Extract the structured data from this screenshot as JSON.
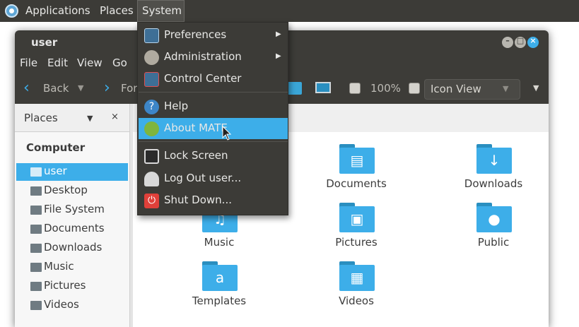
{
  "panel": {
    "menus": [
      "Applications",
      "Places",
      "System"
    ]
  },
  "window": {
    "title": "user",
    "menubar": [
      "File",
      "Edit",
      "View",
      "Go"
    ],
    "toolbar": {
      "back_label": "Back",
      "forward_label": "For",
      "zoom_label": "100%",
      "view_mode": "Icon View"
    }
  },
  "sidepane": {
    "header_label": "Places",
    "section_label": "Computer",
    "items": [
      {
        "label": "user",
        "selected": true
      },
      {
        "label": "Desktop"
      },
      {
        "label": "File System"
      },
      {
        "label": "Documents"
      },
      {
        "label": "Downloads"
      },
      {
        "label": "Music"
      },
      {
        "label": "Pictures"
      },
      {
        "label": "Videos"
      }
    ]
  },
  "content": {
    "items": [
      {
        "label": "Documents",
        "icon": "documents-folder-icon"
      },
      {
        "label": "Downloads",
        "icon": "downloads-folder-icon"
      },
      {
        "label": "Music",
        "icon": "music-folder-icon"
      },
      {
        "label": "Pictures",
        "icon": "pictures-folder-icon"
      },
      {
        "label": "Public",
        "icon": "public-folder-icon"
      },
      {
        "label": "Templates",
        "icon": "templates-folder-icon"
      },
      {
        "label": "Videos",
        "icon": "videos-folder-icon"
      }
    ]
  },
  "system_menu": {
    "items": [
      {
        "label": "Preferences",
        "icon": "preferences-icon",
        "submenu": true
      },
      {
        "label": "Administration",
        "icon": "administration-icon",
        "submenu": true
      },
      {
        "label": "Control Center",
        "icon": "control-center-icon"
      },
      {
        "label": "Help",
        "icon": "help-icon"
      },
      {
        "label": "About MATE",
        "icon": "about-mate-icon",
        "highlighted": true
      },
      {
        "label": "Lock Screen",
        "icon": "lock-screen-icon"
      },
      {
        "label": "Log Out user...",
        "icon": "log-out-icon"
      },
      {
        "label": "Shut Down...",
        "icon": "shut-down-icon"
      }
    ]
  },
  "colors": {
    "accent": "#3daee9",
    "panel_bg": "#3c3b37",
    "menu_bg": "#3c3b37",
    "folder_blue": "#3daee9"
  }
}
